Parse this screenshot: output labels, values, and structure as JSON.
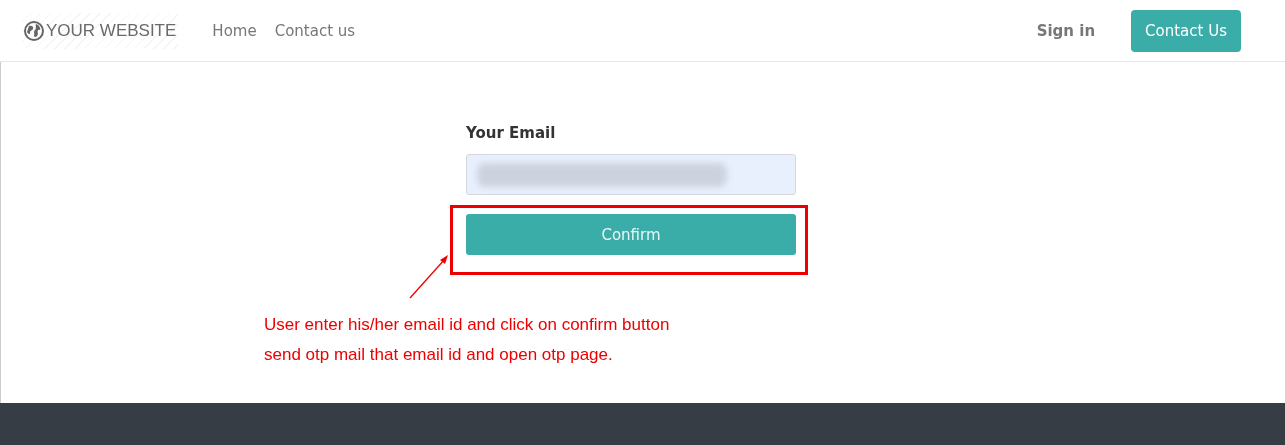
{
  "header": {
    "logo": "YOUR WEBSITE",
    "nav": [
      {
        "label": "Home"
      },
      {
        "label": "Contact us"
      }
    ],
    "sign_in": "Sign in",
    "contact_button": "Contact Us"
  },
  "form": {
    "label": "Your Email",
    "email": {
      "kind": "redacted"
    },
    "confirm_button": "Confirm"
  },
  "annotation": {
    "lines": [
      "User enter his/her email id and click on confirm button",
      "send otp mail that email id and open otp page."
    ]
  }
}
